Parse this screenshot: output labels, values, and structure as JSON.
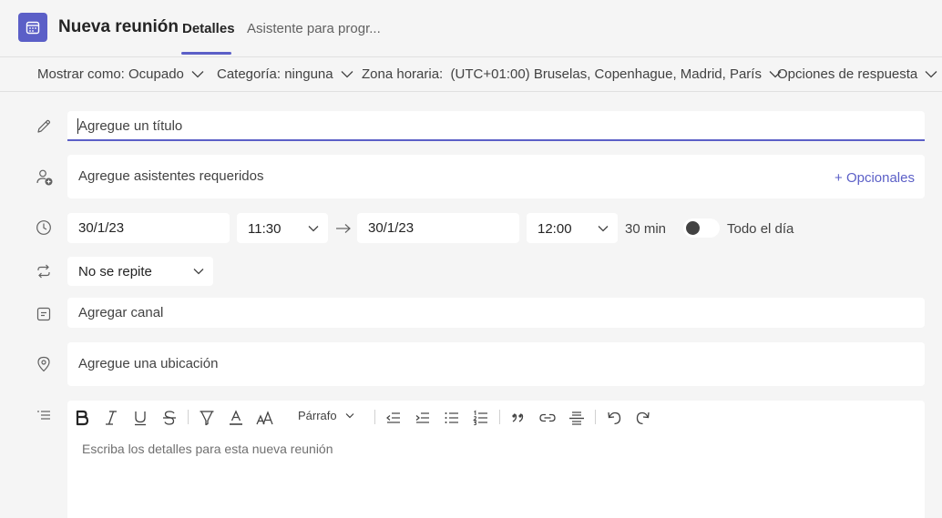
{
  "header": {
    "title": "Nueva reunión",
    "tabs": [
      {
        "label": "Detalles",
        "active": true
      },
      {
        "label": "Asistente para progr..."
      }
    ],
    "icon": "calendar-icon",
    "accent": "#5b5fc7"
  },
  "options_bar": {
    "show_as": "Mostrar como: Ocupado",
    "category": "Categoría: ninguna",
    "timezone": "Zona horaria:  (UTC+01:00) Bruselas, Copenhague, Madrid, París",
    "response_options": "Opciones de respuesta"
  },
  "form": {
    "title_placeholder": "Agregue un título",
    "attendees_placeholder": "Agregue asistentes requeridos",
    "optional_link": "+ Opcionales",
    "start_date": "30/1/23",
    "start_time": "11:30",
    "end_date": "30/1/23",
    "end_time": "12:00",
    "duration": "30 min",
    "all_day_label": "Todo el día",
    "all_day_on": false,
    "repeat": "No se repite",
    "channel_placeholder": "Agregar canal",
    "location_placeholder": "Agregue una ubicación"
  },
  "editor": {
    "paragraph_style": "Párrafo",
    "placeholder": "Escriba los detalles para esta nueva reunión",
    "tools": [
      "bold-icon",
      "italic-icon",
      "underline-icon",
      "strikethrough-icon",
      "highlight-icon",
      "font-color-icon",
      "font-size-icon",
      "decrease-indent-icon",
      "increase-indent-icon",
      "bulleted-list-icon",
      "numbered-list-icon",
      "quote-icon",
      "link-icon",
      "horizontal-rule-icon",
      "undo-icon",
      "redo-icon"
    ]
  }
}
